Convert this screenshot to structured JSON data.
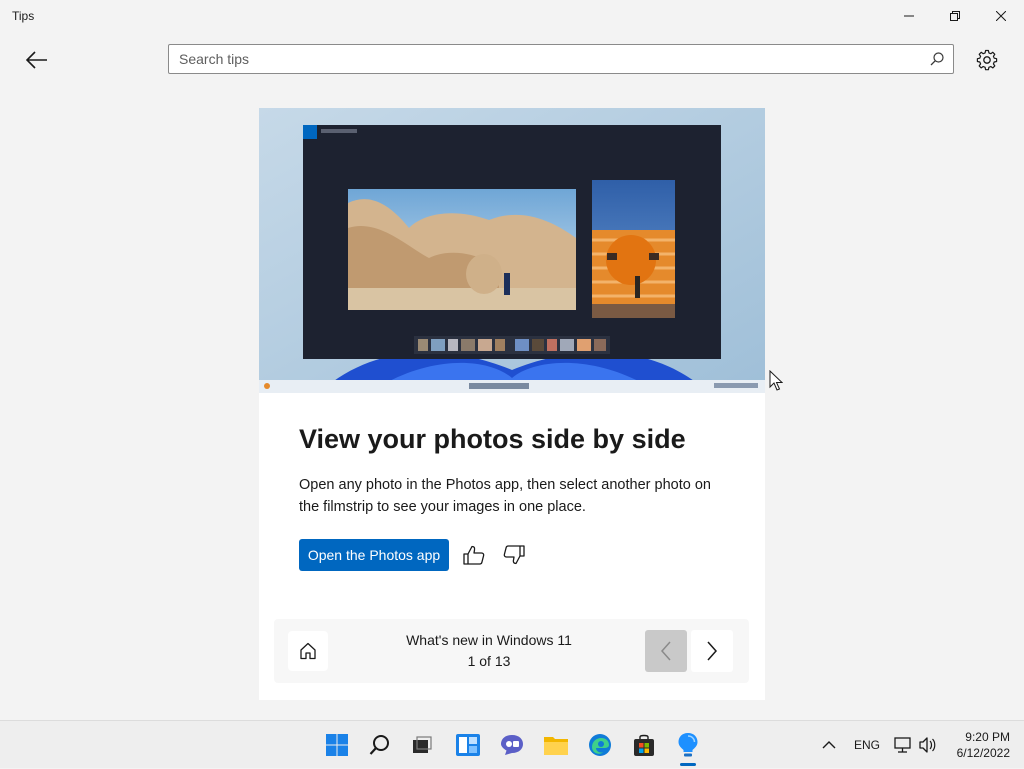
{
  "window": {
    "title": "Tips"
  },
  "search": {
    "placeholder": "Search tips",
    "value": ""
  },
  "tip": {
    "title": "View your photos side by side",
    "description": "Open any photo in the Photos app, then select another photo on the filmstrip to see your images in one place.",
    "action_label": "Open the Photos app"
  },
  "nav": {
    "collection_title": "What's new in Windows 11",
    "position": "1 of 13"
  },
  "tray": {
    "language": "ENG"
  },
  "clock": {
    "time": "9:20 PM",
    "date": "6/12/2022"
  },
  "colors": {
    "accent": "#0067c0",
    "background": "#f3f3f3",
    "card": "#ffffff"
  },
  "icons": [
    "back-arrow-icon",
    "search-icon",
    "gear-icon",
    "thumbs-up-icon",
    "thumbs-down-icon",
    "home-icon",
    "chevron-left-icon",
    "chevron-right-icon",
    "start-icon",
    "search-taskbar-icon",
    "task-view-icon",
    "widgets-icon",
    "chat-icon",
    "file-explorer-icon",
    "edge-icon",
    "store-icon",
    "tips-icon",
    "chevron-up-icon",
    "network-icon",
    "volume-icon"
  ]
}
